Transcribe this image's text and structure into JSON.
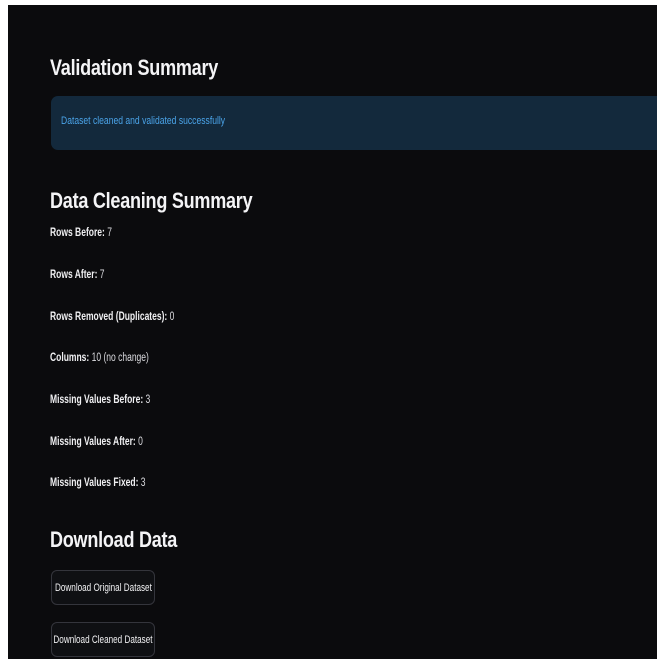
{
  "validation": {
    "title": "Validation Summary",
    "message": "Dataset cleaned and validated successfully"
  },
  "cleaning": {
    "title": "Data Cleaning Summary",
    "stats": [
      {
        "label": "Rows Before:",
        "value": "7"
      },
      {
        "label": "Rows After:",
        "value": "7"
      },
      {
        "label": "Rows Removed (Duplicates):",
        "value": "0"
      },
      {
        "label": "Columns:",
        "value": "10 (no change)"
      },
      {
        "label": "Missing Values Before:",
        "value": "3"
      },
      {
        "label": "Missing Values After:",
        "value": "0"
      },
      {
        "label": "Missing Values Fixed:",
        "value": "3"
      }
    ]
  },
  "download": {
    "title": "Download Data",
    "original_label": "Download Original Dataset",
    "cleaned_label": "Download Cleaned Dataset"
  },
  "colors": {
    "background": "#0b0b0d",
    "info_bg": "#13293c",
    "info_text": "#4aa3e8"
  }
}
